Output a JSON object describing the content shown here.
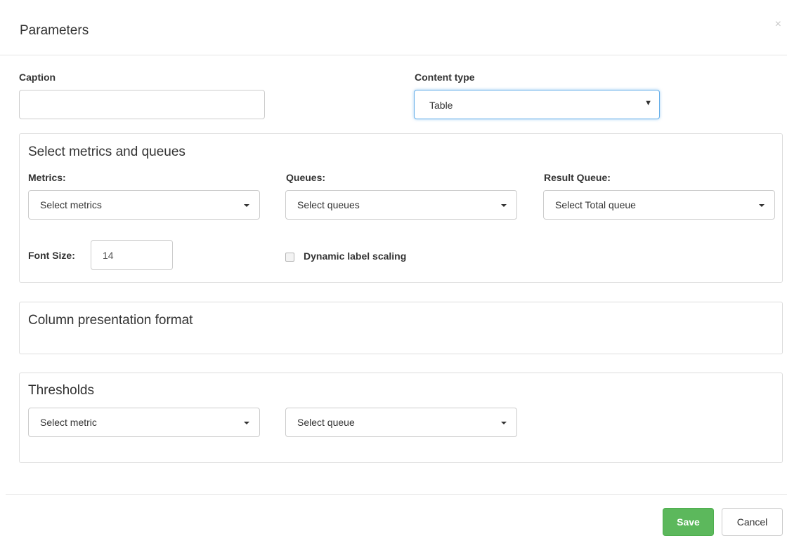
{
  "modal": {
    "title": "Parameters",
    "close_icon": "close-icon"
  },
  "caption": {
    "label": "Caption",
    "value": ""
  },
  "content_type": {
    "label": "Content type",
    "value": "Table"
  },
  "metrics_panel": {
    "title": "Select metrics and queues",
    "metrics_label": "Metrics:",
    "metrics_value": "Select metrics",
    "queues_label": "Queues:",
    "queues_value": "Select queues",
    "result_queue_label": "Result Queue:",
    "result_queue_value": "Select Total queue",
    "font_size_label": "Font Size:",
    "font_size_value": "14",
    "dynamic_label": "Dynamic label scaling"
  },
  "column_panel": {
    "title": "Column presentation format"
  },
  "thresholds_panel": {
    "title": "Thresholds",
    "metric_value": "Select metric",
    "queue_value": "Select queue"
  },
  "footer": {
    "save_label": "Save",
    "cancel_label": "Cancel"
  },
  "colors": {
    "save_green": "#5cb85c",
    "focus_blue": "#66afe9",
    "border_gray": "#cccccc"
  }
}
